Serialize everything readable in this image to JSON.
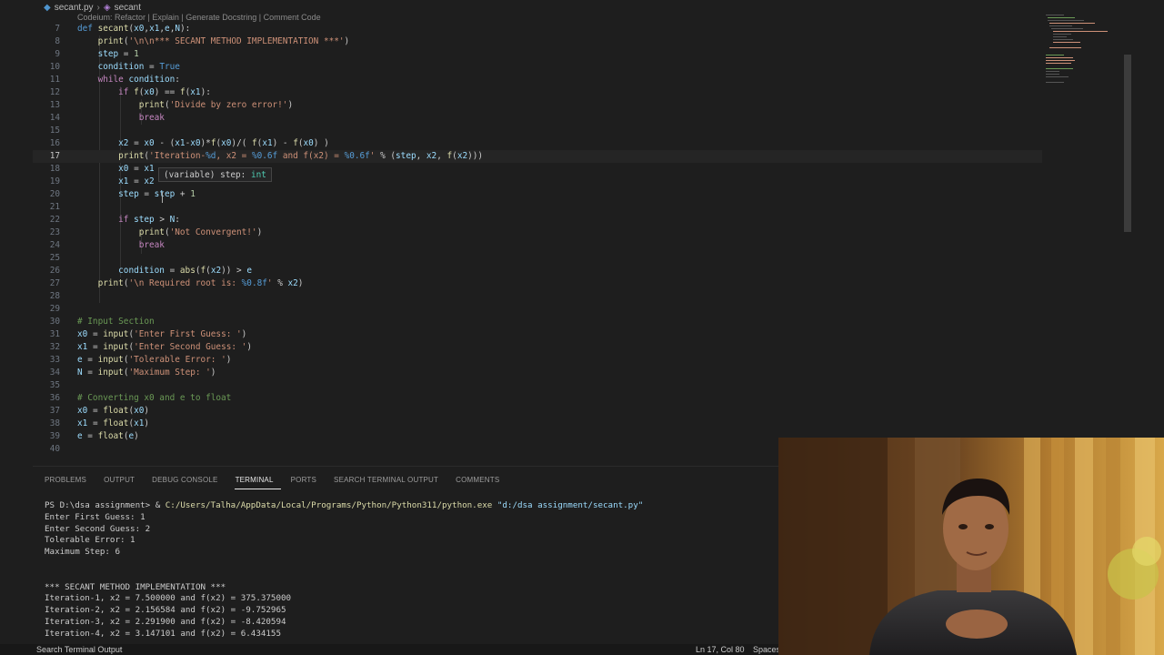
{
  "breadcrumb": {
    "file": "secant.py",
    "symbol": "secant"
  },
  "codelens": "Codeium: Refactor | Explain | Generate Docstring | Comment Code",
  "editor": {
    "lines": [
      {
        "n": "7"
      },
      {
        "n": "8"
      },
      {
        "n": "9"
      },
      {
        "n": "10"
      },
      {
        "n": "11"
      },
      {
        "n": "12"
      },
      {
        "n": "13"
      },
      {
        "n": "14"
      },
      {
        "n": "15"
      },
      {
        "n": "16"
      },
      {
        "n": "17"
      },
      {
        "n": "18"
      },
      {
        "n": "19"
      },
      {
        "n": "20"
      },
      {
        "n": "21"
      },
      {
        "n": "22"
      },
      {
        "n": "23"
      },
      {
        "n": "24"
      },
      {
        "n": "25"
      },
      {
        "n": "26"
      },
      {
        "n": "27"
      },
      {
        "n": "28"
      },
      {
        "n": "29"
      },
      {
        "n": "30"
      },
      {
        "n": "31"
      },
      {
        "n": "32"
      },
      {
        "n": "33"
      },
      {
        "n": "34"
      },
      {
        "n": "35"
      },
      {
        "n": "36"
      },
      {
        "n": "37"
      },
      {
        "n": "38"
      },
      {
        "n": "39"
      },
      {
        "n": "40"
      }
    ],
    "current_line": "17",
    "hover": {
      "prefix": "(variable) step: ",
      "type": "int"
    }
  },
  "panel": {
    "tabs": [
      "PROBLEMS",
      "OUTPUT",
      "DEBUG CONSOLE",
      "TERMINAL",
      "PORTS",
      "SEARCH TERMINAL OUTPUT",
      "COMMENTS"
    ],
    "active_tab": "TERMINAL",
    "terminal": {
      "prompt": "PS D:\\dsa assignment> & ",
      "exe": "C:/Users/Talha/AppData/Local/Programs/Python/Python311/python.exe",
      "script": " \"d:/dsa assignment/secant.py\"",
      "lines": [
        "Enter First Guess: 1",
        "Enter Second Guess: 2",
        "Tolerable Error: 1",
        "Maximum Step: 6",
        "",
        "",
        "*** SECANT METHOD IMPLEMENTATION ***",
        "Iteration-1, x2 = 7.500000 and f(x2) = 375.375000",
        "Iteration-2, x2 = 2.156584 and f(x2) = -9.752965",
        "Iteration-3, x2 = 2.291900 and f(x2) = -8.420594",
        "Iteration-4, x2 = 3.147101 and f(x2) = 6.434155"
      ]
    }
  },
  "statusbar": {
    "left": "Search Terminal Output",
    "position": "Ln 17, Col 80",
    "spaces": "Spaces"
  },
  "colors": {
    "editor_bg": "#1e1e1e",
    "keyword": "#c586c0",
    "string": "#ce9178",
    "function": "#dcdcaa",
    "variable": "#9cdcfe",
    "comment": "#6a9955"
  }
}
